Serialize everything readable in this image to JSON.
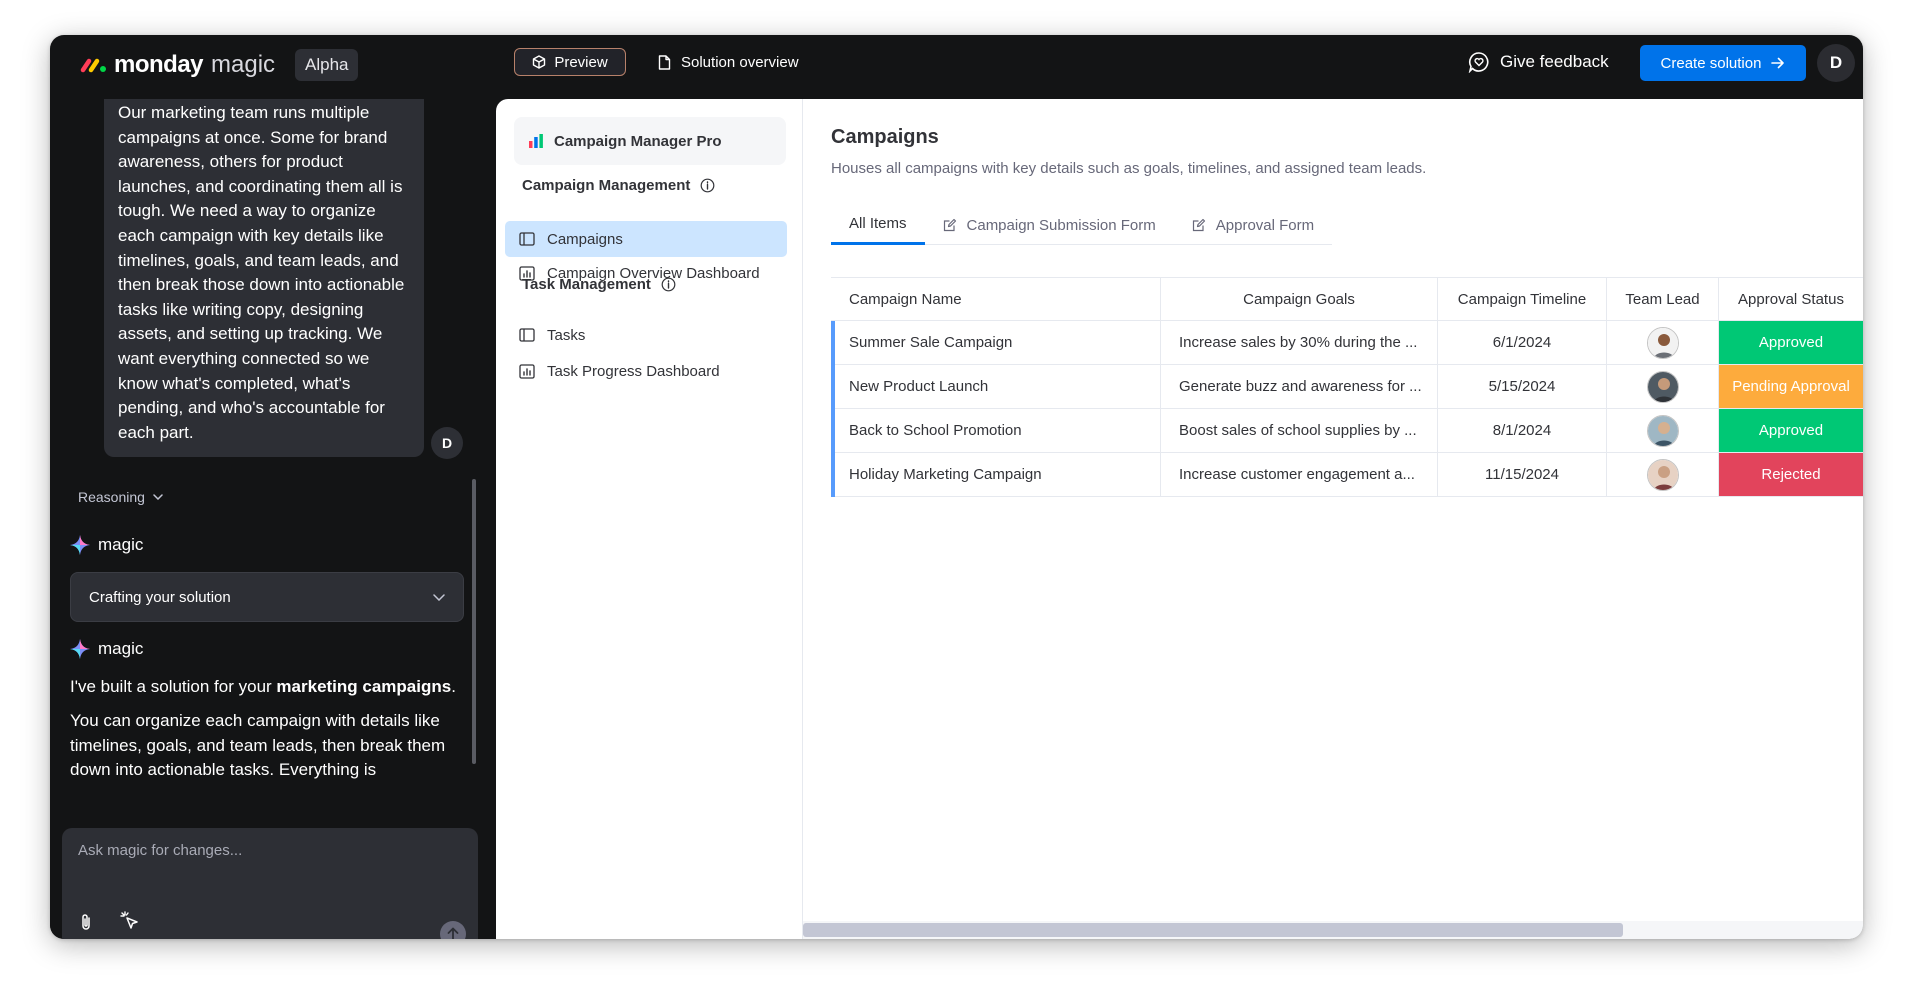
{
  "topbar": {
    "logo_word": "monday",
    "logo_magic": "magic",
    "alpha_badge": "Alpha",
    "preview_label": "Preview",
    "overview_label": "Solution overview",
    "feedback_label": "Give feedback",
    "create_label": "Create solution",
    "avatar_initial": "D"
  },
  "chat": {
    "user_message": "Our marketing team runs multiple campaigns at once. Some for brand awareness, others for product launches, and coordinating them all is tough. We need a way to organize each campaign with key details like timelines, goals, and team leads, and then break those down into actionable tasks like writing copy, designing assets, and setting up tracking. We want everything connected so we know what's completed, what's pending, and who's accountable for each part.",
    "user_initial": "D",
    "reasoning_label": "Reasoning",
    "magic_label_1": "magic",
    "crafting_label": "Crafting your solution",
    "magic_label_2": "magic",
    "reply_line_prefix": "I've built a solution for your ",
    "reply_bold": "marketing campaigns",
    "reply_line_suffix": ".",
    "reply_paragraph": "You can organize each campaign with details like timelines, goals, and team leads, then break them down into actionable tasks. Everything is",
    "composer_placeholder": "Ask magic for changes..."
  },
  "nav": {
    "app_name": "Campaign Manager Pro",
    "section_1": "Campaign Management",
    "section_1_items": [
      "Campaigns",
      "Campaign Overview Dashboard"
    ],
    "section_2": "Task Management",
    "section_2_items": [
      "Tasks",
      "Task Progress Dashboard"
    ]
  },
  "content": {
    "title": "Campaigns",
    "subtitle": "Houses all campaigns with key details such as goals, timelines, and assigned team leads.",
    "tabs": [
      "All Items",
      "Campaign Submission Form",
      "Approval Form"
    ],
    "columns": [
      "Campaign Name",
      "Campaign Goals",
      "Campaign Timeline",
      "Team Lead",
      "Approval Status"
    ],
    "rows": [
      {
        "name": "Summer Sale Campaign",
        "goal": "Increase sales by 30% during the ...",
        "timeline": "6/1/2024",
        "status": "Approved"
      },
      {
        "name": "New Product Launch",
        "goal": "Generate buzz and awareness for ...",
        "timeline": "5/15/2024",
        "status": "Pending Approval"
      },
      {
        "name": "Back to School Promotion",
        "goal": "Boost sales of school supplies by ...",
        "timeline": "8/1/2024",
        "status": "Approved"
      },
      {
        "name": "Holiday Marketing Campaign",
        "goal": "Increase customer engagement a...",
        "timeline": "11/15/2024",
        "status": "Rejected"
      }
    ]
  },
  "colors": {
    "accent": "#0073ea",
    "approved": "#00c875",
    "pending": "#fdab3d",
    "rejected": "#e2445c",
    "selected_nav": "#cce5ff"
  }
}
